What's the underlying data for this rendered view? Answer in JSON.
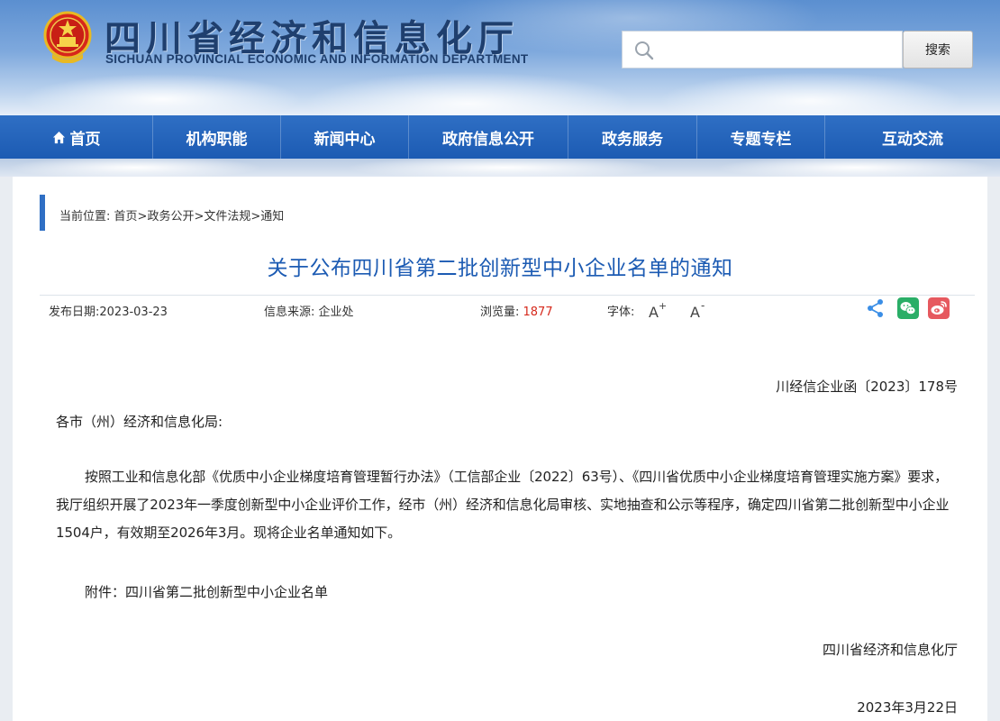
{
  "header": {
    "title_cn": "四川省经济和信息化厅",
    "title_en": "SICHUAN PROVINCIAL ECONOMIC AND INFORMATION DEPARTMENT",
    "emblem_icon": "national-emblem-icon",
    "search": {
      "placeholder": "",
      "value": "",
      "button_label": "搜索"
    }
  },
  "nav": {
    "items": [
      {
        "label": "首页",
        "icon": "home-icon"
      },
      {
        "label": "机构职能"
      },
      {
        "label": "新闻中心"
      },
      {
        "label": "政府信息公开"
      },
      {
        "label": "政务服务"
      },
      {
        "label": "专题专栏"
      },
      {
        "label": "互动交流"
      }
    ],
    "color": "#1c5bb3"
  },
  "breadcrumb": {
    "prefix": "当前位置:",
    "items": [
      "首页",
      "政务公开",
      "文件法规",
      "通知"
    ],
    "separator": ">"
  },
  "article": {
    "title": "关于公布四川省第二批创新型中小企业名单的通知",
    "meta": {
      "publish_date": "发布日期:2023-03-23",
      "source": "信息来源:  企业处",
      "views_label": "浏览量: ",
      "views_value": "1877",
      "font_label": "字体:",
      "font_increase": "A+",
      "font_decrease": "A-"
    },
    "share_icons": [
      "share-icon",
      "wechat-icon",
      "weibo-icon"
    ],
    "doc_number": "川经信企业函〔2023〕178号",
    "salutation": "各市（州）经济和信息化局:",
    "paragraph": "按照工业和信息化部《优质中小企业梯度培育管理暂行办法》（工信部企业〔2022〕63号）、《四川省优质中小企业梯度培育管理实施方案》要求，我厅组织开展了2023年一季度创新型中小企业评价工作，经市（州）经济和信息化局审核、实地抽查和公示等程序，确定四川省第二批创新型中小企业1504户，有效期至2026年3月。现将企业名单通知如下。",
    "attachment": "附件：四川省第二批创新型中小企业名单",
    "signature": "四川省经济和信息化厅",
    "date": "2023年3月22日"
  },
  "colors": {
    "accent": "#1c5bb3",
    "views": "#d62a1d",
    "wechat": "#2aae67",
    "weibo": "#e6595f",
    "share": "#3a8ee6"
  }
}
